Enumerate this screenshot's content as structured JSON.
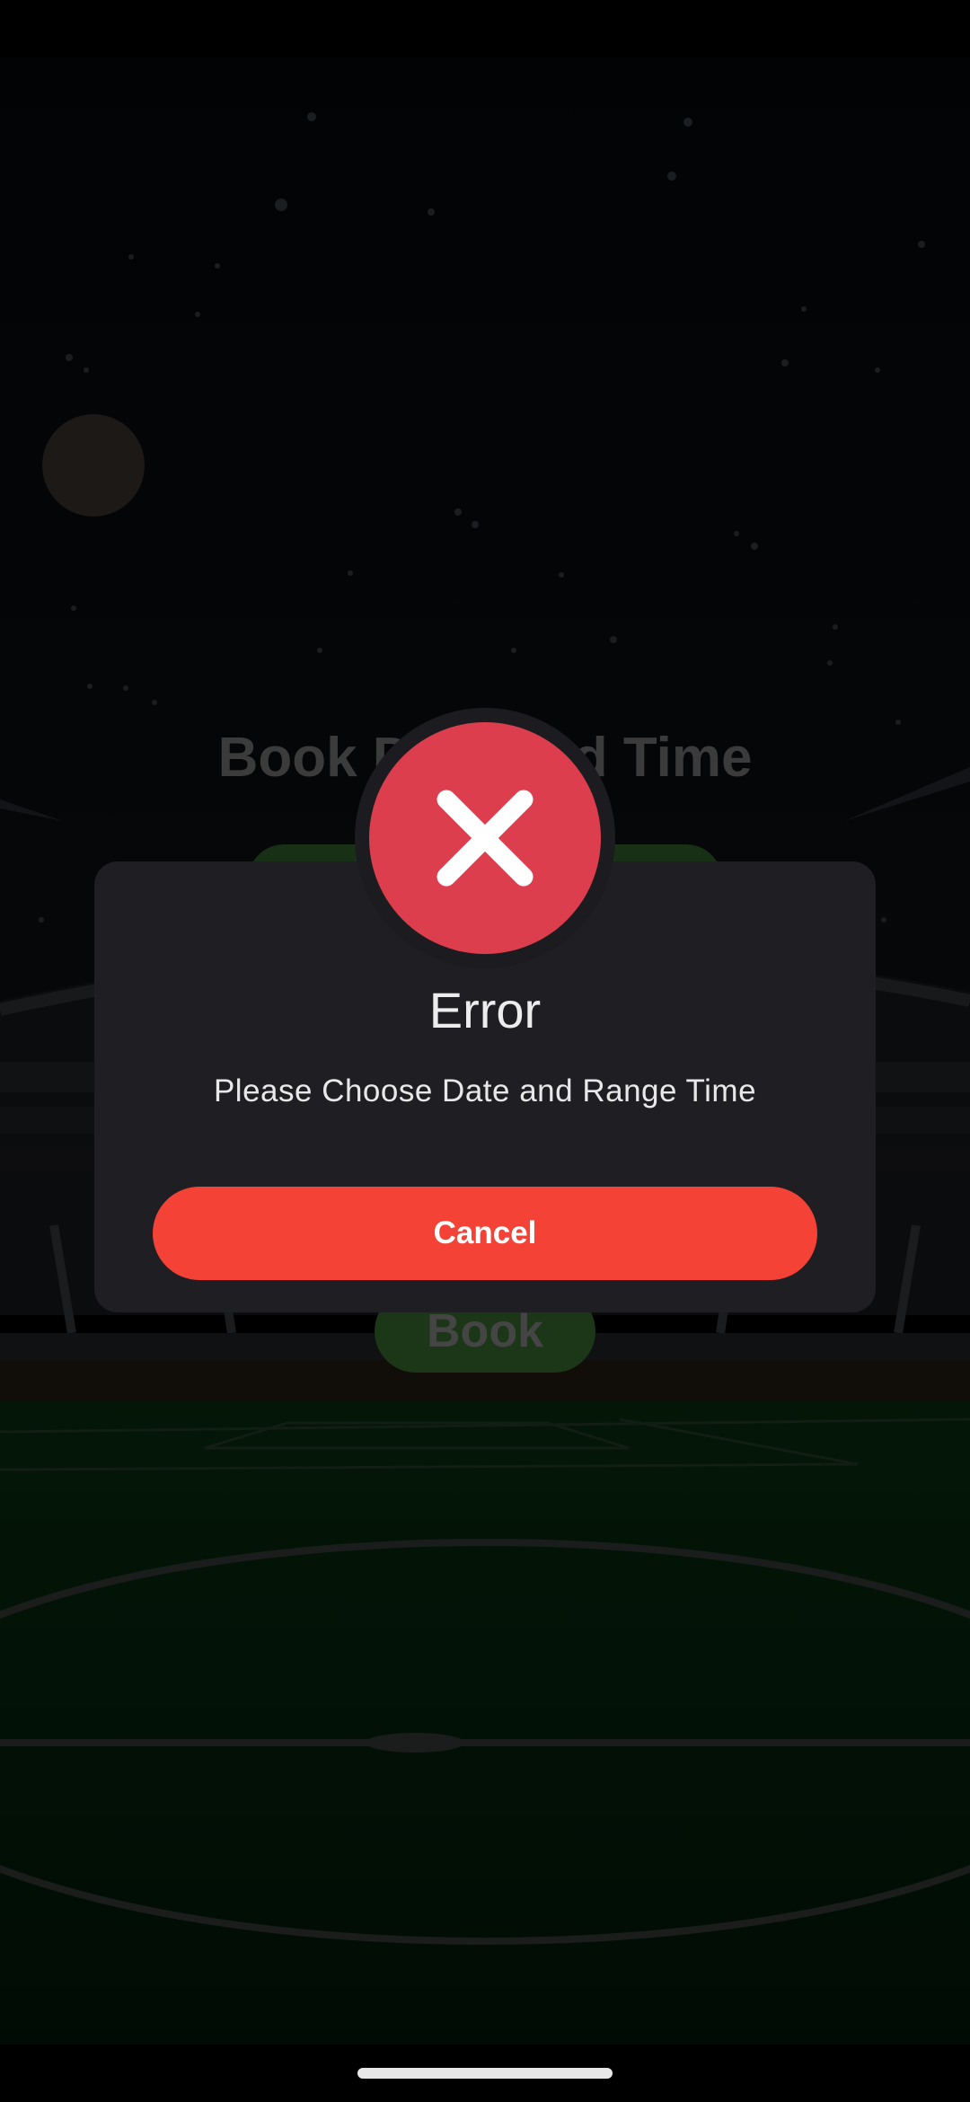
{
  "background": {
    "title": "Book Date and Time",
    "book_button_label": "Book"
  },
  "dialog": {
    "icon": "close-icon",
    "title": "Error",
    "message": "Please Choose Date and Range Time",
    "cancel_label": "Cancel"
  },
  "colors": {
    "error_icon": "#dc3e4d",
    "cancel_button": "#f44336",
    "dialog_background": "#1f1e22"
  }
}
